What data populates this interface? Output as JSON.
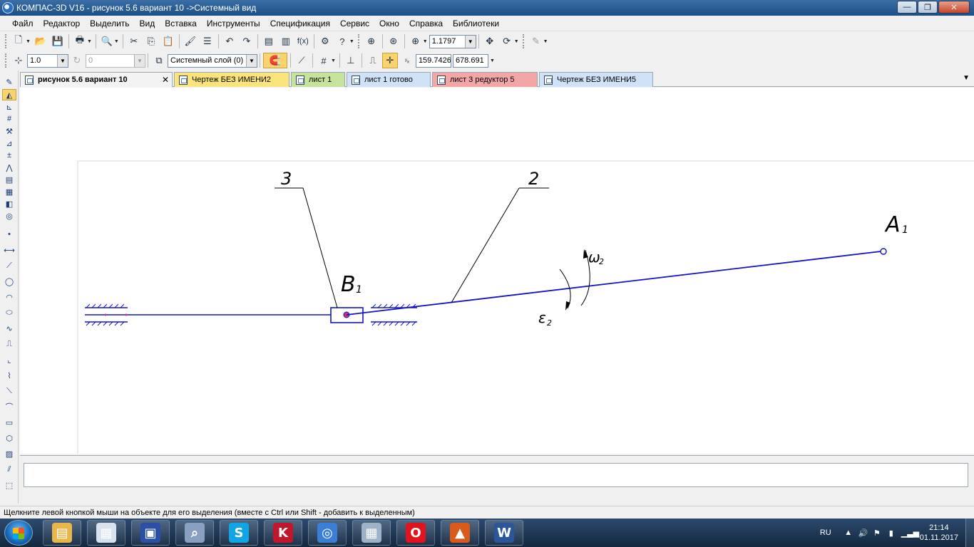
{
  "window": {
    "title": "КОМПАС-3D V16  - рисунок 5.6 вариант 10 ->Системный вид",
    "controls": {
      "minimize": "—",
      "maximize": "❐",
      "close": "✕"
    }
  },
  "menu": [
    "Файл",
    "Редактор",
    "Выделить",
    "Вид",
    "Вставка",
    "Инструменты",
    "Спецификация",
    "Сервис",
    "Окно",
    "Справка",
    "Библиотеки"
  ],
  "toolbar1": {
    "zoom_value": "1.1797"
  },
  "toolbar2": {
    "step_value": "1.0",
    "angle_value": "0",
    "layer_value": "Системный слой (0)",
    "coord_x": "159.7426",
    "coord_y": "678.691"
  },
  "tabs": [
    {
      "label": "рисунок 5.6 вариант 10",
      "color": "#f3f3f3",
      "active": true,
      "close": "✕"
    },
    {
      "label": "Чертеж БЕЗ ИМЕНИ2",
      "color": "#fbe47b"
    },
    {
      "label": "лист 1",
      "color": "#c5e39a"
    },
    {
      "label": "лист  1 готово",
      "color": "#cfe2f7"
    },
    {
      "label": "лист 3 редуктор 5",
      "color": "#f2a6a6"
    },
    {
      "label": "Чертеж БЕЗ ИМЕНИ5",
      "color": "#cfe2f7"
    }
  ],
  "drawing": {
    "line_color": "#1414c8",
    "point_color": "#d0306b",
    "labels": {
      "leader3": "3",
      "leader2": "2",
      "point_a": "A",
      "point_a_sub": "1",
      "point_b": "B",
      "point_b_sub": "1",
      "omega": "ω",
      "omega_sub": "2",
      "epsilon": "ε",
      "epsilon_sub": "2"
    }
  },
  "status": "Щелкните левой кнопкой мыши на объекте для его выделения (вместе с Ctrl или Shift - добавить к выделенным)",
  "taskbar": {
    "apps": [
      {
        "name": "file-explorer",
        "glyph": "▤",
        "color": "#e8b64a"
      },
      {
        "name": "presentation",
        "glyph": "▦",
        "color": "#d8e2ee"
      },
      {
        "name": "save-disk",
        "glyph": "▣",
        "color": "#2c4fa8"
      },
      {
        "name": "search-tool",
        "glyph": "⌕",
        "color": "#8aa0c0"
      },
      {
        "name": "skype",
        "glyph": "S",
        "color": "#12a5e6"
      },
      {
        "name": "kaspersky",
        "glyph": "K",
        "color": "#c0182a"
      },
      {
        "name": "kompas",
        "glyph": "◎",
        "color": "#3a7fd5"
      },
      {
        "name": "calculator",
        "glyph": "▦",
        "color": "#9fb3c8"
      },
      {
        "name": "opera",
        "glyph": "O",
        "color": "#e0141e"
      },
      {
        "name": "matlab",
        "glyph": "▲",
        "color": "#d95a1c"
      },
      {
        "name": "word",
        "glyph": "W",
        "color": "#2b579a"
      }
    ],
    "language": "RU",
    "time": "21:14",
    "date": "01.11.2017"
  }
}
